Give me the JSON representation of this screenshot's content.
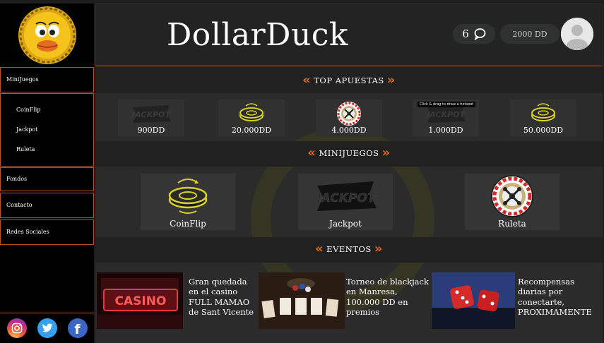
{
  "app": {
    "brand": "DollarDuck"
  },
  "header": {
    "message_count": "6",
    "balance": "2000 DD"
  },
  "sidebar": {
    "minijuegos_label": "MiniJuegos",
    "sub_items": [
      {
        "label": "CoinFlip"
      },
      {
        "label": "Jackpot"
      },
      {
        "label": "Ruleta"
      }
    ],
    "fondos_label": "Fondos",
    "contacto_label": "Contacto",
    "redes_label": "Redes Sociales",
    "social": [
      {
        "icon": "instagram-icon",
        "glyph": "◎"
      },
      {
        "icon": "twitter-icon",
        "glyph": "t"
      },
      {
        "icon": "facebook-icon",
        "glyph": "f"
      }
    ]
  },
  "sections": {
    "top": "TOP APUESTAS",
    "minijuegos": "MINIJUEGOS",
    "eventos": "EVENTOS"
  },
  "top_apuestas": [
    {
      "game": "jackpot",
      "value": "900DD"
    },
    {
      "game": "coinflip",
      "value": "20.000DD"
    },
    {
      "game": "ruleta",
      "value": "4.000DD"
    },
    {
      "game": "jackpot",
      "value": "1.000DD"
    },
    {
      "game": "coinflip",
      "value": "50.000DD"
    }
  ],
  "tooltip": "Click & drag to draw a hotspot",
  "games": [
    {
      "name": "CoinFlip"
    },
    {
      "name": "Jackpot"
    },
    {
      "name": "Ruleta"
    }
  ],
  "jackpot_text": "JACKPOT",
  "events": [
    {
      "text": "Gran quedada en el casino FULL MAMAO de Sant Vicente",
      "image": "casino-sign"
    },
    {
      "text": "Torneo de  blackjack en Manresa, 100.000 DD en premios",
      "image": "playing-cards"
    },
    {
      "text": "Recompensas diarias por conectarte, PROXIMAMENTE",
      "image": "dice"
    }
  ],
  "colors": {
    "accent": "#e0661f",
    "border": "#b5542a",
    "coin": "#d8d12a",
    "duck_yellow": "#f6c21c"
  }
}
